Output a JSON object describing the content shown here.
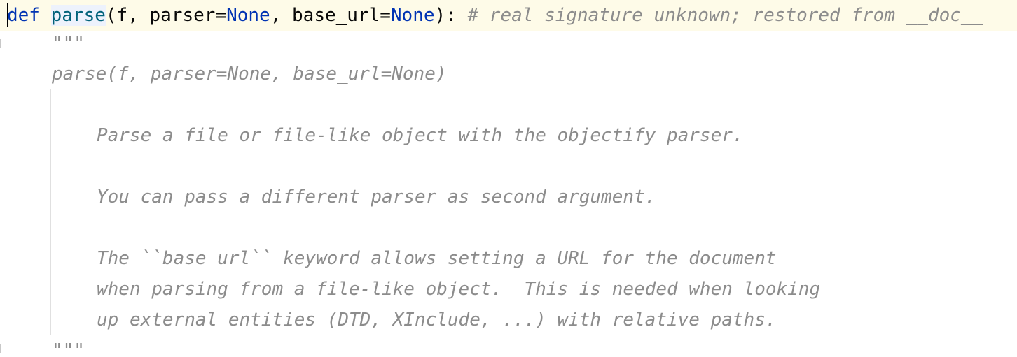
{
  "code": {
    "line1": {
      "kw_def": "def",
      "func_name": "parse",
      "open_paren": "(f, parser=",
      "none1": "None",
      "mid": ", base_url=",
      "none2": "None",
      "close": "): ",
      "comment": "# real signature unknown; restored from __doc__"
    },
    "docstring_open": "\"\"\"",
    "sig_line": "parse(f, parser=None, base_url=None)",
    "desc1": "Parse a file or file-like object with the objectify parser.",
    "desc2": "You can pass a different parser as second argument.",
    "desc3a": "The ``base_url`` keyword allows setting a URL for the document",
    "desc3b": "when parsing from a file-like object.  This is needed when looking",
    "desc3c": "up external entities (DTD, XInclude, ...) with relative paths.",
    "docstring_close": "\"\"\""
  },
  "colors": {
    "keyword": "#0033b3",
    "function": "#00627a",
    "comment": "#8c8c8c",
    "caret_line": "#fefbe8"
  }
}
